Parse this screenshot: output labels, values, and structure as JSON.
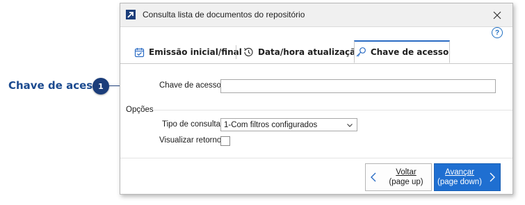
{
  "callout": {
    "label": "Chave de acesso",
    "badge": "1"
  },
  "window": {
    "title": "Consulta lista de documentos do repositório",
    "help": "?"
  },
  "tabs": [
    {
      "label": "Emissão inicial/final",
      "icon": "calendar-check-icon",
      "active": false
    },
    {
      "label": "Data/hora atualização",
      "icon": "history-icon",
      "active": false
    },
    {
      "label": "Chave de acesso",
      "icon": "key-icon",
      "active": true
    }
  ],
  "form": {
    "chave_label": "Chave de acesso",
    "chave_value": "",
    "group_label": "Opções",
    "tipo_label": "Tipo de consulta",
    "tipo_value": "1-Com filtros configurados",
    "visualizar_label": "Visualizar retorno",
    "visualizar_checked": false
  },
  "buttons": {
    "back_line1": "Voltar",
    "back_line2": "(page up)",
    "next_line1": "Avançar",
    "next_line2": "(page down)"
  },
  "colors": {
    "accent": "#1f6fd1",
    "callout": "#1b3d7a",
    "active_tab_border": "#2b6cc4"
  }
}
